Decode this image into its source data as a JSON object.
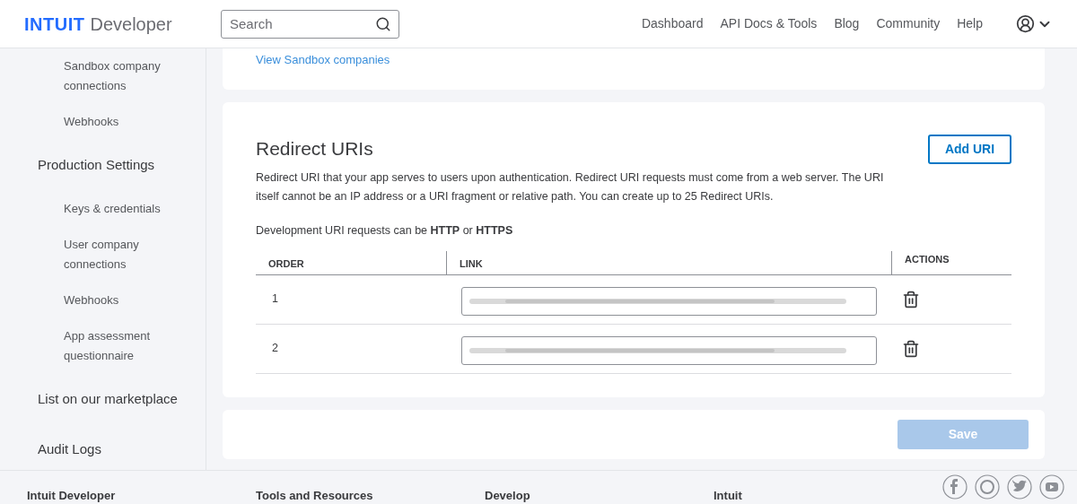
{
  "header": {
    "logo_brand": "INTUIT",
    "logo_product": "Developer",
    "search": {
      "placeholder": "Search"
    },
    "nav": [
      "Dashboard",
      "API Docs & Tools",
      "Blog",
      "Community",
      "Help"
    ]
  },
  "sidebar": {
    "items": [
      {
        "label": "Sandbox company connections",
        "kind": "sub"
      },
      {
        "label": "Webhooks",
        "kind": "sub"
      },
      {
        "label": "Production Settings",
        "kind": "section"
      },
      {
        "label": "Keys & credentials",
        "kind": "sub"
      },
      {
        "label": "User company connections",
        "kind": "sub"
      },
      {
        "label": "Webhooks",
        "kind": "sub"
      },
      {
        "label": "App assessment questionnaire",
        "kind": "sub"
      },
      {
        "label": "List on our marketplace",
        "kind": "section"
      },
      {
        "label": "Audit Logs",
        "kind": "section"
      }
    ]
  },
  "sandbox_link": "View Sandbox companies",
  "redirect": {
    "title": "Redirect URIs",
    "add_button": "Add URI",
    "description": "Redirect URI that your app serves to users upon authentication. Redirect URI requests must come from a web server. The URI itself cannot be an IP address or a URI fragment or relative path. You can create up to 25 Redirect URIs.",
    "note": "Development URI requests can be **HTTP** or **HTTPS**",
    "table": {
      "columns": [
        "ORDER",
        "LINK",
        "ACTIONS"
      ],
      "rows": [
        {
          "order": "1"
        },
        {
          "order": "2"
        }
      ]
    }
  },
  "save_button": {
    "label": "Save",
    "disabled": true
  },
  "footer": {
    "headings": [
      "Intuit Developer",
      "Tools and Resources",
      "Develop",
      "Intuit"
    ]
  }
}
